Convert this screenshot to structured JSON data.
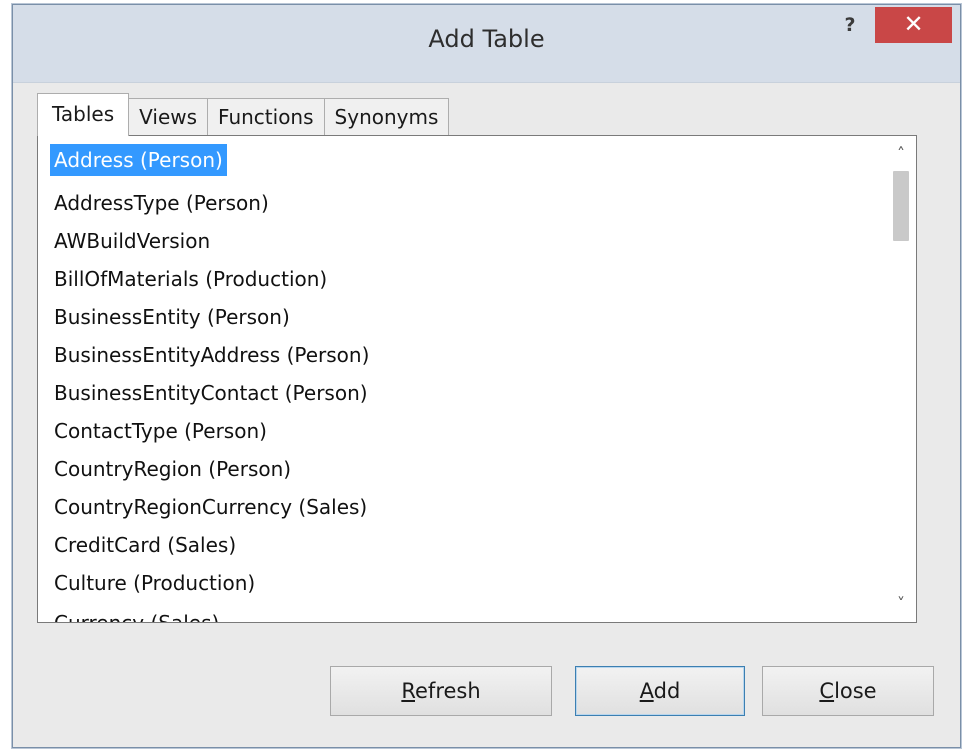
{
  "window": {
    "title": "Add Table",
    "help_label": "?",
    "close_label": "✕"
  },
  "tabs": [
    {
      "label": "Tables",
      "active": true
    },
    {
      "label": "Views",
      "active": false
    },
    {
      "label": "Functions",
      "active": false
    },
    {
      "label": "Synonyms",
      "active": false
    }
  ],
  "list": {
    "selected_index": 0,
    "items": [
      "Address (Person)",
      "AddressType (Person)",
      "AWBuildVersion",
      "BillOfMaterials (Production)",
      "BusinessEntity (Person)",
      "BusinessEntityAddress (Person)",
      "BusinessEntityContact (Person)",
      "ContactType (Person)",
      "CountryRegion (Person)",
      "CountryRegionCurrency (Sales)",
      "CreditCard (Sales)",
      "Culture (Production)",
      "Currency (Sales)"
    ],
    "scroll_up_icon": "chevron-up-icon",
    "scroll_down_icon": "chevron-down-icon"
  },
  "buttons": {
    "refresh": {
      "accel": "R",
      "rest": "efresh"
    },
    "add": {
      "accel": "A",
      "rest": "dd"
    },
    "close": {
      "accel": "C",
      "rest": "lose"
    }
  }
}
